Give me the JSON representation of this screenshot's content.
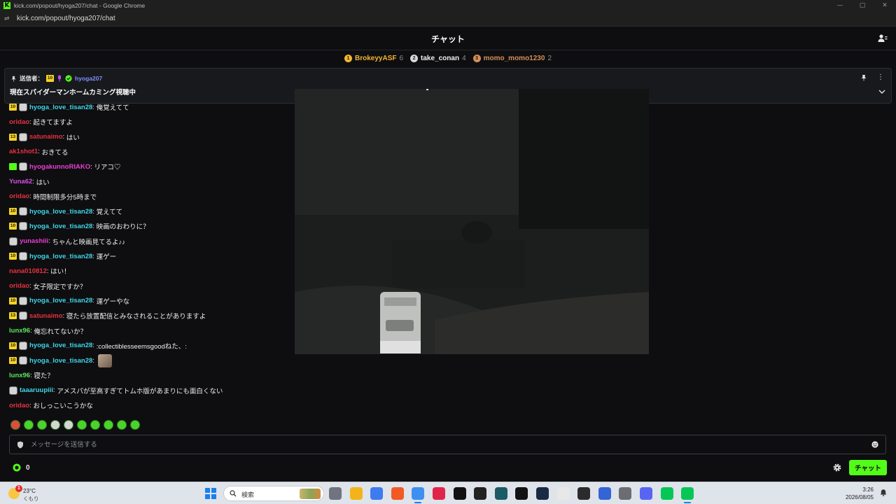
{
  "window": {
    "title": "kick.com/popout/hyoga207/chat - Google Chrome",
    "url": "kick.com/popout/hyoga207/chat",
    "controls": [
      "—",
      "▢",
      "✕"
    ]
  },
  "chat": {
    "title": "チャット",
    "leaderboard": [
      {
        "rank": "1",
        "name": "BrokeyyASF",
        "count": "6",
        "color": "#f2b533"
      },
      {
        "rank": "2",
        "name": "take_conan",
        "count": "4",
        "color": "#d7d7d7"
      },
      {
        "rank": "3",
        "name": "momo_momo1230",
        "count": "2",
        "color": "#d48f5a"
      }
    ],
    "pinned": {
      "label": "送信者：",
      "badge": "10",
      "user": "hyoga207",
      "text": "現在スパイダーマンホームカミング視聴中"
    },
    "messages": [
      {
        "badge": "10",
        "avatar": true,
        "user": "hyoga_love_tisan28",
        "text": "俺覚えてて",
        "color": "#3fd6e8"
      },
      {
        "user": "oridao",
        "text": "起きてますよ",
        "color": "#e8313e"
      },
      {
        "badge": "13",
        "avatar": true,
        "user": "satunaimo",
        "text": "はい",
        "color": "#e8313e"
      },
      {
        "user": "ak1shot1",
        "text": "おきてる",
        "color": "#e8313e"
      },
      {
        "badge": "bot",
        "avatar": true,
        "user": "hyogakunnoRIAKO",
        "text": "リアコ♡",
        "color": "#e93fd4"
      },
      {
        "user": "Yuna62",
        "text": "はい",
        "color": "#d84fe8"
      },
      {
        "user": "oridao",
        "text": "時間制限多分5時まで",
        "color": "#e8313e"
      },
      {
        "badge": "10",
        "avatar": true,
        "user": "hyoga_love_tisan28",
        "text": "覚えてて",
        "color": "#3fd6e8"
      },
      {
        "badge": "10",
        "avatar": true,
        "user": "hyoga_love_tisan28",
        "text": "映画のおわりに？",
        "color": "#3fd6e8"
      },
      {
        "avatar": true,
        "user": "yunashiii",
        "text": "ちゃんと映画見てるよ♪♪",
        "color": "#e93fd4"
      },
      {
        "badge": "10",
        "avatar": true,
        "user": "hyoga_love_tisan28",
        "text": "運ゲー",
        "color": "#3fd6e8"
      },
      {
        "user": "nana010812",
        "text": "はい！",
        "color": "#e8313e"
      },
      {
        "user": "oridao",
        "text": "女子限定ですか？",
        "color": "#e8313e"
      },
      {
        "badge": "10",
        "avatar": true,
        "user": "hyoga_love_tisan28",
        "text": "運ゲーやな",
        "color": "#3fd6e8"
      },
      {
        "badge": "13",
        "avatar": true,
        "user": "satunaimo",
        "text": "寝たら放置配信とみなされることがありますよ",
        "color": "#e8313e"
      },
      {
        "user": "lunx96",
        "text": "俺忘れてないか？",
        "color": "#5ce65c"
      },
      {
        "badge": "10",
        "avatar": true,
        "user": "hyoga_love_tisan28",
        "text": ":collectiblesseemsgoodねた、:",
        "color": "#3fd6e8"
      },
      {
        "badge": "10",
        "avatar": true,
        "user": "hyoga_love_tisan28",
        "text": "",
        "emote": true,
        "color": "#3fd6e8"
      },
      {
        "user": "lunx96",
        "text": "寝た？",
        "color": "#5ce65c"
      },
      {
        "avatar": true,
        "user": "taaaruupiii",
        "text": "アメスパが至高すぎてトムホ版があまりにも面白くない",
        "color": "#3fd6e8"
      },
      {
        "user": "oridao",
        "text": "おしっこいこうかな",
        "color": "#e8313e"
      }
    ],
    "emotes_count": 10,
    "input": {
      "placeholder": "メッセージを送信する"
    },
    "points": "0",
    "send_label": "チャット"
  },
  "taskbar": {
    "weather": {
      "temp": "23°C",
      "condition": "くもり",
      "alert": "1"
    },
    "search_placeholder": "検索",
    "apps": [
      "task-view",
      "file-explorer",
      "app-blue",
      "brave",
      "chrome",
      "app-red",
      "tiktok",
      "app-dark",
      "app-teal",
      "app-green",
      "steam",
      "app-multi",
      "obs",
      "app-star",
      "settings",
      "discord",
      "line",
      "line-active"
    ],
    "time": "3:26",
    "date": "2026/08/05"
  }
}
